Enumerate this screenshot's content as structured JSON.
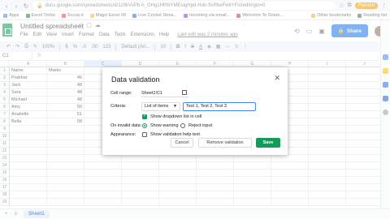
{
  "browser": {
    "url": "docs.google.com/spreadsheets/d/1z9kVvPb-h_GHg1HRNYMEsigHpd-Hdn-9xRbeFwkYFsI/edit#gid=0",
    "profile_label": "Paused",
    "bookmarks": [
      {
        "label": "Apps",
        "color": "#4285f4"
      },
      {
        "label": "Excel Tricks",
        "color": "#188038"
      },
      {
        "label": "Scoop.it",
        "color": "#ea4335"
      },
      {
        "label": "Magic Excel 09",
        "color": "#fbbc04"
      },
      {
        "label": "Live Cricket Strea...",
        "color": "#1a73e8"
      },
      {
        "label": "Incoming via email...",
        "color": "#9334e6"
      },
      {
        "label": "Welcome To Share...",
        "color": "#d93025"
      }
    ],
    "other_bookmarks": "Other bookmarks",
    "reading_list": "Reading list"
  },
  "doc": {
    "title": "Untitled spreadsheet",
    "menus": [
      "File",
      "Edit",
      "View",
      "Insert",
      "Format",
      "Data",
      "Tools",
      "Extensions",
      "Help"
    ],
    "last_edit": "Last edit was 2 minutes ago",
    "share_label": "Share"
  },
  "toolbar": {
    "zoom": "100%",
    "currency": "$",
    "percent": "%",
    "formats": "123",
    "font": "Default (Ari...",
    "font_size": "10"
  },
  "formula_bar": {
    "name_box": "C1",
    "fx": "fx"
  },
  "grid": {
    "columns": [
      "A",
      "B",
      "C",
      "D",
      "E",
      "F",
      "G",
      "H",
      "I",
      "J"
    ],
    "rows": [
      {
        "num": "1",
        "name": "Name",
        "marks": "Marks",
        "is_header": true
      },
      {
        "num": "2",
        "name": "Prabhat",
        "marks": "46"
      },
      {
        "num": "3",
        "name": "Jack",
        "marks": "48"
      },
      {
        "num": "4",
        "name": "Sara",
        "marks": "48"
      },
      {
        "num": "5",
        "name": "Michael",
        "marks": "48"
      },
      {
        "num": "6",
        "name": "Amy",
        "marks": "50"
      },
      {
        "num": "7",
        "name": "Anabelle",
        "marks": "51"
      },
      {
        "num": "8",
        "name": "Bella",
        "marks": "58"
      },
      {
        "num": "9",
        "name": "",
        "marks": ""
      },
      {
        "num": "10",
        "name": "",
        "marks": ""
      },
      {
        "num": "11",
        "name": "",
        "marks": ""
      },
      {
        "num": "12",
        "name": "",
        "marks": ""
      },
      {
        "num": "13",
        "name": "",
        "marks": ""
      },
      {
        "num": "14",
        "name": "",
        "marks": ""
      },
      {
        "num": "15",
        "name": "",
        "marks": ""
      },
      {
        "num": "16",
        "name": "",
        "marks": ""
      },
      {
        "num": "17",
        "name": "",
        "marks": ""
      },
      {
        "num": "18",
        "name": "",
        "marks": ""
      },
      {
        "num": "19",
        "name": "",
        "marks": ""
      }
    ]
  },
  "sheet_tabs": {
    "active": "Sheet1"
  },
  "dialog": {
    "title": "Data validation",
    "cell_range_label": "Cell range:",
    "cell_range_value": "Sheet1!C1",
    "criteria_label": "Criteria:",
    "criteria_type": "List of items",
    "criteria_value": "Test 1, Test 2, Test 3",
    "show_dropdown": "Show dropdown list in cell",
    "invalid_label": "On invalid data:",
    "show_warning": "Show warning",
    "reject_input": "Reject input",
    "appearance_label": "Appearance:",
    "show_help": "Show validation help text",
    "cancel": "Cancel",
    "remove": "Remove validation",
    "save": "Save"
  }
}
